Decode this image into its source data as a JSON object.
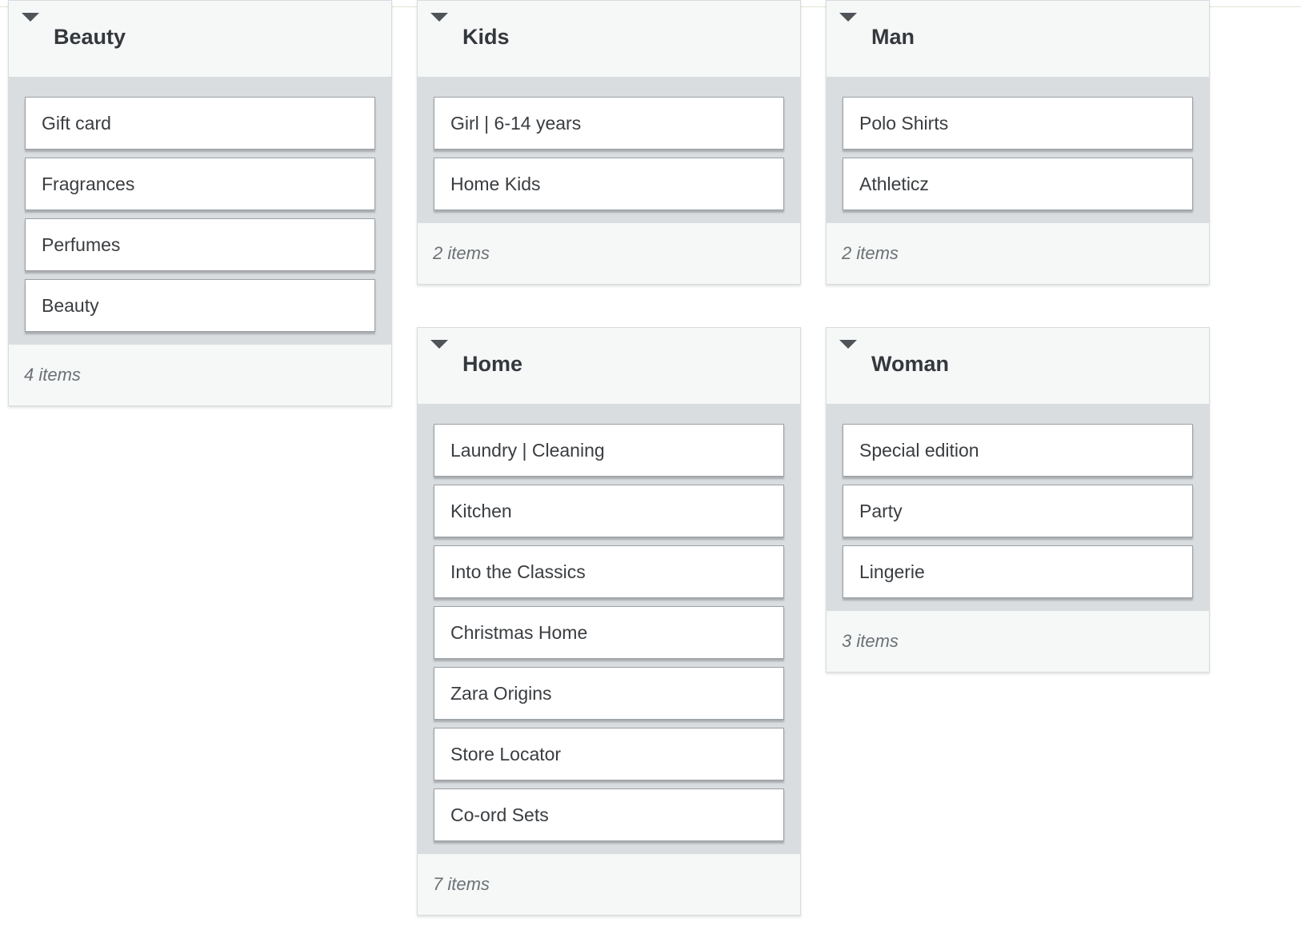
{
  "groups": [
    {
      "title": "Beauty",
      "items": [
        "Gift card",
        "Fragrances",
        "Perfumes",
        "Beauty"
      ],
      "count_label": "4 items"
    },
    {
      "title": "Kids",
      "items": [
        "Girl | 6-14 years",
        "Home Kids"
      ],
      "count_label": "2 items"
    },
    {
      "title": "Man",
      "items": [
        "Polo Shirts",
        "Athleticz"
      ],
      "count_label": "2 items"
    },
    {
      "title": "Home",
      "items": [
        "Laundry | Cleaning",
        "Kitchen",
        "Into the Classics",
        "Christmas Home",
        "Zara Origins",
        "Store Locator",
        "Co-ord Sets"
      ],
      "count_label": "7 items"
    },
    {
      "title": "Woman",
      "items": [
        "Special edition",
        "Party",
        "Lingerie"
      ],
      "count_label": "3 items"
    }
  ],
  "icons": {
    "collapse": "caret-down-icon"
  }
}
